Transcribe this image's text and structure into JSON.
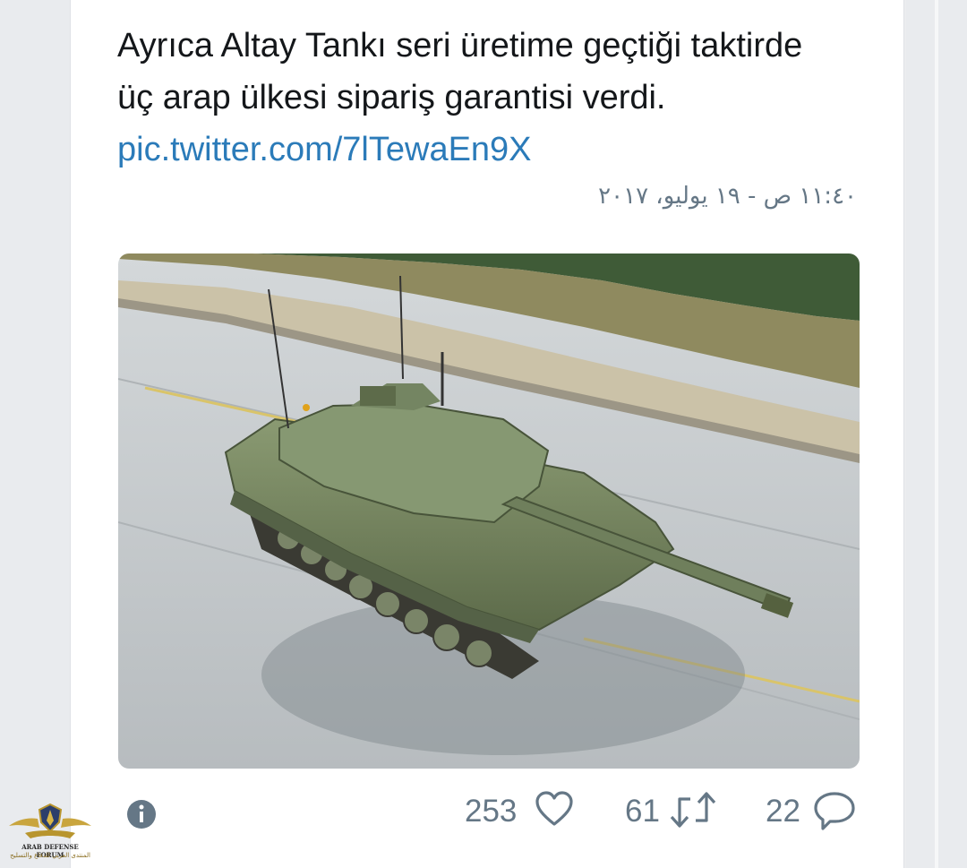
{
  "tweet": {
    "text_plain": "Ayrıca Altay Tankı seri üretime geçtiği taktirde üç arap ülkesi sipariş garantisi verdi.",
    "link": "pic.twitter.com/7lTewaEn9X",
    "timestamp": "١١:٤٠ ص - ١٩ يوليو، ٢٠١٧"
  },
  "media": {
    "alt_icon": "tank-photo"
  },
  "actions": {
    "likes": "253",
    "retweets": "61",
    "replies": "22"
  },
  "watermark": {
    "line1": "ARAB DEFENSE FORUM",
    "line2": "المنتدى العربي للدفاع والتسليح"
  },
  "colors": {
    "link": "#2b7bb9",
    "text": "#14171a",
    "muted": "#657786"
  }
}
